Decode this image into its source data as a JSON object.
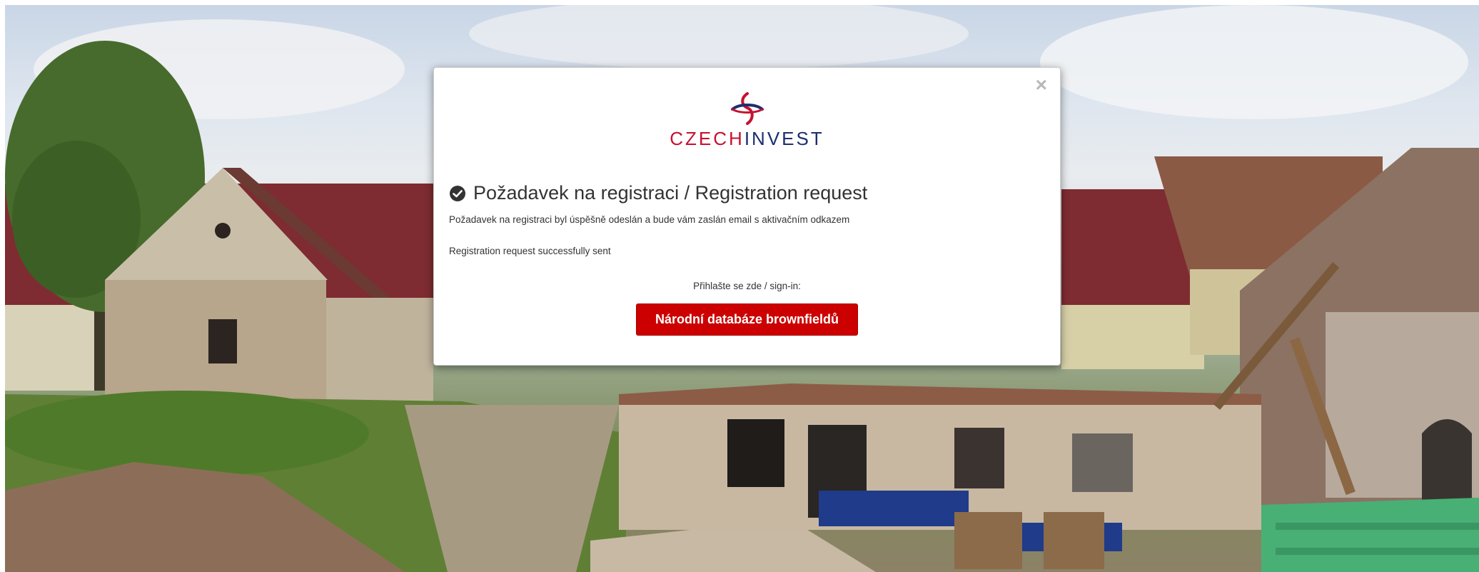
{
  "modal": {
    "close_symbol": "×",
    "logo": {
      "brand_part1": "CZECH",
      "brand_part2": "INVEST"
    },
    "title": "Požadavek na registraci / Registration request",
    "message_cz": "Požadavek na registraci byl úspěšně odeslán a bude vám zaslán email s aktivačním odkazem",
    "message_en": "Registration request successfully sent",
    "signin_label": "Přihlašte se zde / sign-in:",
    "signin_button": "Národní databáze brownfieldů"
  },
  "colors": {
    "button_bg": "#cc0000",
    "brand_red": "#c8102e",
    "brand_blue": "#1c2f6e"
  }
}
